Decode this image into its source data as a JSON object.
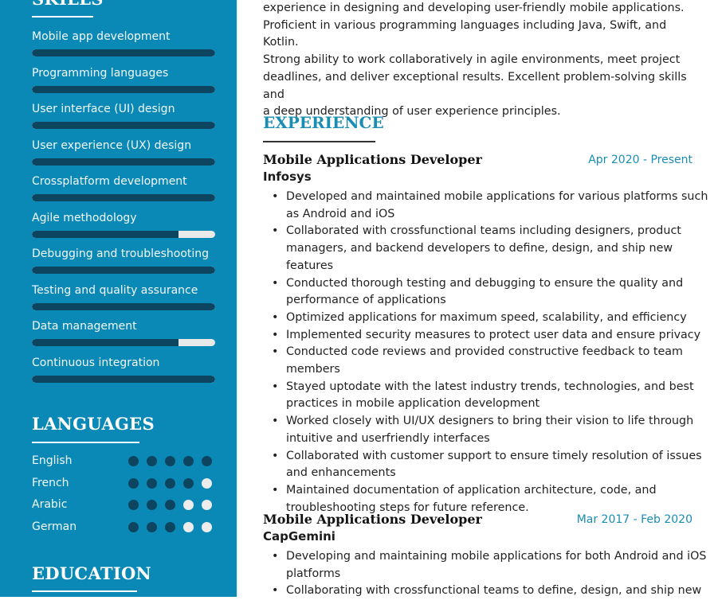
{
  "colors": {
    "sidebar_bg": "#0b89b6",
    "bar_filled": "#0d4560",
    "bar_empty": "#e9e9e9",
    "accent": "#1a8db3"
  },
  "sidebar": {
    "skills": {
      "title": "SKILLS",
      "items": [
        {
          "label": "Mobile app development",
          "level": 1.0
        },
        {
          "label": "Programming languages",
          "level": 1.0
        },
        {
          "label": "User interface (UI) design",
          "level": 1.0
        },
        {
          "label": "User experience (UX) design",
          "level": 1.0
        },
        {
          "label": "Crossplatform development",
          "level": 1.0
        },
        {
          "label": "Agile methodology",
          "level": 0.8
        },
        {
          "label": "Debugging and troubleshooting",
          "level": 1.0
        },
        {
          "label": "Testing and quality assurance",
          "level": 1.0
        },
        {
          "label": "Data management",
          "level": 0.8
        },
        {
          "label": "Continuous integration",
          "level": 1.0
        }
      ]
    },
    "languages": {
      "title": "LANGUAGES",
      "max_level": 5,
      "items": [
        {
          "name": "English",
          "level": 5
        },
        {
          "name": "French",
          "level": 4
        },
        {
          "name": "Arabic",
          "level": 3
        },
        {
          "name": "German",
          "level": 3
        }
      ]
    },
    "education": {
      "title": "EDUCATION"
    }
  },
  "summary": {
    "lines": [
      "experience in designing and developing user-friendly mobile applications.",
      "Proficient in various programming languages including Java, Swift, and Kotlin.",
      "Strong ability to work collaboratively in agile environments, meet project",
      "deadlines, and deliver exceptional results. Excellent problem-solving skills and",
      "a deep understanding of user experience principles."
    ]
  },
  "experience": {
    "title": "EXPERIENCE",
    "jobs": [
      {
        "title": "Mobile Applications Developer",
        "dates": "Apr 2020 - Present",
        "company": "Infosys",
        "bullets": [
          "Developed and maintained mobile applications for various platforms such as Android and iOS",
          "Collaborated with crossfunctional teams including designers, product managers, and backend developers to define, design, and ship new features",
          "Conducted thorough testing and debugging to ensure the quality and performance of applications",
          "Optimized applications for maximum speed, scalability, and efficiency",
          "Implemented security measures to protect user data and ensure privacy",
          "Conducted code reviews and provided constructive feedback to team members",
          "Stayed uptodate with the latest industry trends, technologies, and best practices in mobile application development",
          "Worked closely with UI/UX designers to bring their vision to life through intuitive and userfriendly interfaces",
          "Collaborated with customer support to ensure timely resolution of issues and enhancements",
          "Maintained documentation of application architecture, code, and troubleshooting steps for future reference."
        ]
      },
      {
        "title": "Mobile Applications Developer",
        "dates": "Mar 2017 - Feb 2020",
        "company": "CapGemini",
        "bullets": [
          "Developing and maintaining mobile applications for both Android and iOS platforms",
          "Collaborating with crossfunctional teams to define, design, and ship new"
        ]
      }
    ]
  }
}
